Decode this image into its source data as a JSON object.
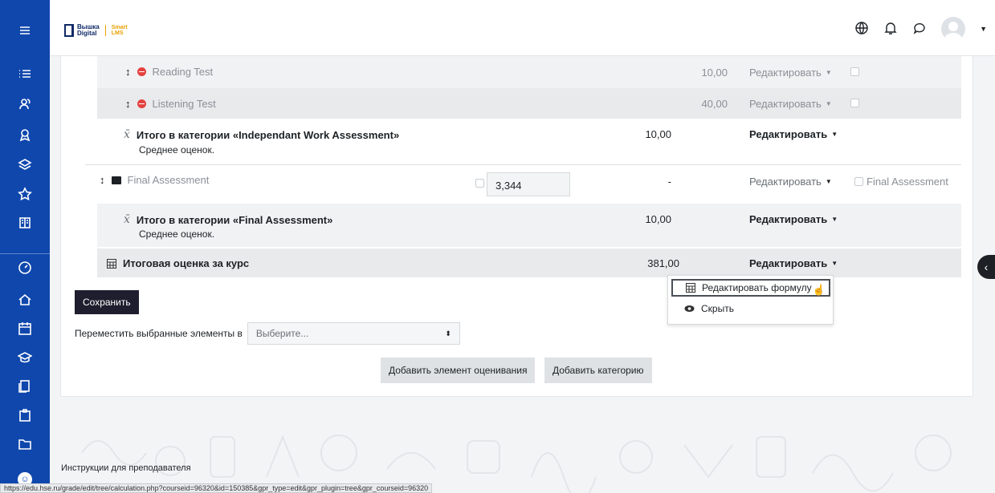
{
  "topbar": {
    "logo_line1": "Вышка",
    "logo_line2": "Digital",
    "logo_brand1": "Smart",
    "logo_brand2": "LMS"
  },
  "rows": [
    {
      "name": "Reading Test",
      "value": "10,00",
      "edit": "Редактировать"
    },
    {
      "name": "Listening Test",
      "value": "40,00",
      "edit": "Редактировать"
    },
    {
      "name": "Итого в категории «Independant Work Assessment»",
      "sub": "Среднее оценок.",
      "value": "10,00",
      "edit": "Редактировать"
    },
    {
      "name": "Final Assessment",
      "input_value": "3,344",
      "value": "-",
      "edit": "Редактировать",
      "check_label": "Final Assessment"
    },
    {
      "name": "Итого в категории «Final Assessment»",
      "sub": "Среднее оценок.",
      "value": "10,00",
      "edit": "Редактировать"
    },
    {
      "name": "Итоговая оценка за курс",
      "value": "381,00",
      "edit": "Редактировать"
    }
  ],
  "dropdown": {
    "items": [
      {
        "label": "Редактировать формулу",
        "icon": "calculator-icon"
      },
      {
        "label": "Скрыть",
        "icon": "eye-icon"
      }
    ]
  },
  "actions": {
    "save": "Сохранить",
    "move_label": "Переместить выбранные элементы в",
    "move_select": "Выберите...",
    "add_item": "Добавить элемент оценивания",
    "add_category": "Добавить категорию"
  },
  "footer": {
    "instructions": "Инструкции для преподавателя",
    "status_url": "https://edu.hse.ru/grade/edit/tree/calculation.php?courseid=96320&id=150385&gpr_type=edit&gpr_plugin=tree&gpr_courseid=96320"
  },
  "colors": {
    "rail": "#0f47ad",
    "dark_button": "#1e1e2e",
    "red_badge": "#e4423f"
  }
}
